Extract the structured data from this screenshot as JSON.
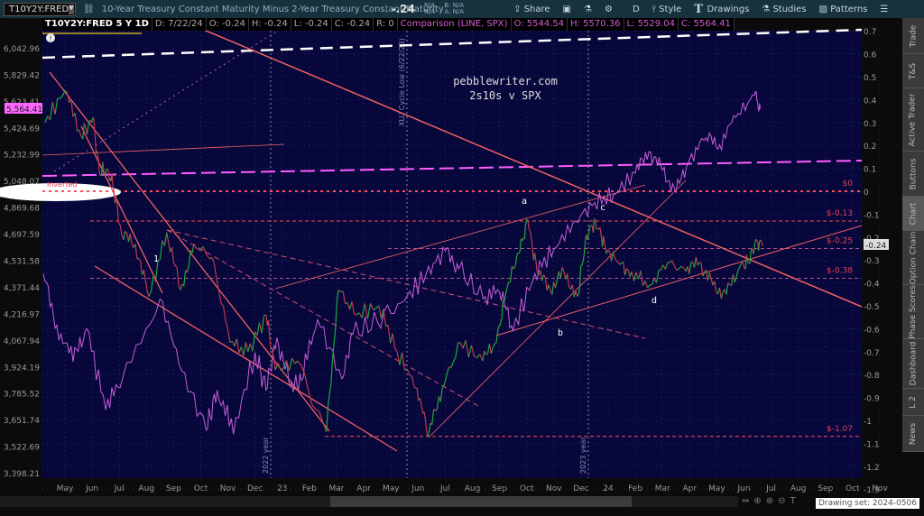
{
  "header": {
    "symbol": "T10Y2Y:FRED",
    "description": "10-Year Treasury Constant Maturity Minus 2-Year Treasury Constant Maturity",
    "last": "-.24",
    "na1": "N/A",
    "na2": "N/A",
    "bid": "B: N/A",
    "ask": "A: N/A",
    "toolbar": {
      "share": "Share",
      "aggregation": "D",
      "style": "Style",
      "drawings": "Drawings",
      "studies": "Studies",
      "patterns": "Patterns"
    }
  },
  "info": {
    "symbol": "T10Y2Y:FRED 5 Y 1D",
    "date": "D: 7/22/24",
    "open": "O: -0.24",
    "high": "H: -0.24",
    "low": "L: -0.24",
    "close": "C: -0.24",
    "r": "R: 0",
    "comparison": "Comparison (LINE, SPX)",
    "c_open": "O: 5544.54",
    "c_high": "H: 5570.36",
    "c_low": "L: 5529.04",
    "c_close": "C: 5564.41"
  },
  "side_tabs": [
    "Trade",
    "T&S",
    "Active Trader",
    "Buttons",
    "Chart",
    "Option Chain",
    "Phase Scores",
    "Dashboard",
    "L 2",
    "News"
  ],
  "active_tab": "Chart",
  "drawing_set": "Drawing set: 2024-0506",
  "chart_data": {
    "type": "line",
    "title": "pebblewriter.com",
    "subtitle": "2s10s v SPX",
    "left_axis": {
      "label": "SPX",
      "scale": "log",
      "ticks": [
        "6,042.96",
        "5,829.42",
        "5,623.41",
        "5,424.69",
        "5,232.99",
        "5,048.07",
        "4,869.68",
        "4,697.59",
        "4,531.58",
        "4,371.44",
        "4,216.97",
        "4,067.94",
        "3,924.19",
        "3,785.52",
        "3,651.74",
        "3,522.69",
        "3,398.21"
      ],
      "current": "5,564.41"
    },
    "right_axis": {
      "label": "T10Y2Y",
      "ylim": [
        -1.3,
        0.7
      ],
      "ticks": [
        "0.7",
        "0.6",
        "0.5",
        "0.4",
        "0.3",
        "0.2",
        "0.1",
        "0",
        "-0.1",
        "-0.2",
        "-0.3",
        "-0.4",
        "-0.5",
        "-0.6",
        "-0.7",
        "-0.8",
        "-0.9",
        "-1",
        "-1.1",
        "-1.2",
        "-1.3"
      ],
      "current": "-0.24"
    },
    "x_ticks": [
      "May",
      "Jun",
      "Jul",
      "Aug",
      "Sep",
      "Oct",
      "Nov",
      "Dec",
      "23",
      "Feb",
      "Mar",
      "Apr",
      "May",
      "Jun",
      "Jul",
      "Aug",
      "Sep",
      "Oct",
      "Nov",
      "Dec",
      "24",
      "Feb",
      "Mar",
      "Apr",
      "May",
      "Jun",
      "Jul",
      "Aug",
      "Sep",
      "Oct",
      "Nov"
    ],
    "x_unit": "months since May 2022",
    "series": [
      {
        "name": "T10Y2Y",
        "axis": "right",
        "x": [
          -0.73,
          0,
          0.6,
          1.03,
          1.26,
          1.6,
          1.76,
          2.09,
          2.59,
          3.09,
          3.75,
          4.25,
          4.75,
          5.42,
          6.08,
          6.74,
          7.41,
          7.74,
          8.57,
          9.63,
          10.07,
          10.73,
          11.56,
          12.23,
          12.96,
          13.39,
          13.89,
          14.55,
          15.38,
          15.88,
          16.21,
          16.71,
          17.04,
          17.38,
          17.87,
          18.37,
          18.87,
          19.2,
          19.53,
          19.87,
          20.37,
          20.86,
          21.53,
          22.19,
          22.86,
          23.36,
          23.85,
          24.35,
          24.85,
          25.18,
          25.45,
          25.68
        ],
        "y": [
          0.3,
          0.44,
          0.24,
          0.32,
          0.09,
          0.09,
          0.03,
          -0.19,
          -0.23,
          -0.46,
          -0.18,
          -0.43,
          -0.23,
          -0.29,
          -0.66,
          -0.7,
          -0.54,
          -0.78,
          -0.74,
          -1.05,
          -0.43,
          -0.54,
          -0.5,
          -0.7,
          -0.86,
          -1.06,
          -0.86,
          -0.66,
          -0.74,
          -0.66,
          -0.46,
          -0.27,
          -0.13,
          -0.35,
          -0.43,
          -0.35,
          -0.46,
          -0.19,
          -0.13,
          -0.23,
          -0.31,
          -0.35,
          -0.41,
          -0.31,
          -0.35,
          -0.31,
          -0.41,
          -0.45,
          -0.33,
          -0.31,
          -0.21,
          -0.24
        ]
      },
      {
        "name": "SPX",
        "axis": "left",
        "x": [
          -0.8,
          -0.3,
          0.3,
          0.8,
          1.5,
          2.1,
          3.5,
          4.3,
          5.2,
          5.6,
          6.2,
          7.0,
          7.4,
          7.8,
          8.3,
          8.7,
          9.3,
          10.2,
          10.6,
          11.5,
          12.5,
          13.3,
          14.0,
          14.5,
          15.4,
          16.0,
          16.5,
          17.3,
          18.0,
          18.8,
          19.5,
          20.2,
          21.0,
          21.5,
          22.0,
          22.5,
          23.0,
          23.6,
          24.1,
          24.7,
          25.4,
          25.6
        ],
        "y": [
          4450,
          4150,
          3950,
          4130,
          3700,
          3850,
          4300,
          3900,
          3600,
          3800,
          3580,
          4000,
          3800,
          4080,
          3820,
          3850,
          4180,
          3860,
          4100,
          4170,
          4290,
          4450,
          4590,
          4480,
          4300,
          4340,
          4120,
          4450,
          4600,
          4780,
          4900,
          4950,
          5100,
          5250,
          5120,
          4970,
          5200,
          5350,
          5300,
          5500,
          5670,
          5564
        ]
      }
    ],
    "annotations": {
      "inverted": "Inverted",
      "a": "a",
      "b": "b",
      "c": "c",
      "d": "d",
      "one": "1",
      "xlu": "XLU Cycle Low (6/22/23)",
      "y2022": "2022 year",
      "y2023": "2023 year"
    },
    "price_levels": [
      {
        "label": "$0",
        "value": 0
      },
      {
        "label": "$-0.13",
        "value": -0.13
      },
      {
        "label": "$-0.25",
        "value": -0.25
      },
      {
        "label": "$-0.38",
        "value": -0.38
      },
      {
        "label": "$-1.07",
        "value": -1.07
      }
    ],
    "colors": {
      "background": "#07073c",
      "up": "#1fa83a",
      "down": "#c0394b",
      "spx": "#c55fd6",
      "trend": "#f06262",
      "accent": "#ff5cff"
    }
  }
}
